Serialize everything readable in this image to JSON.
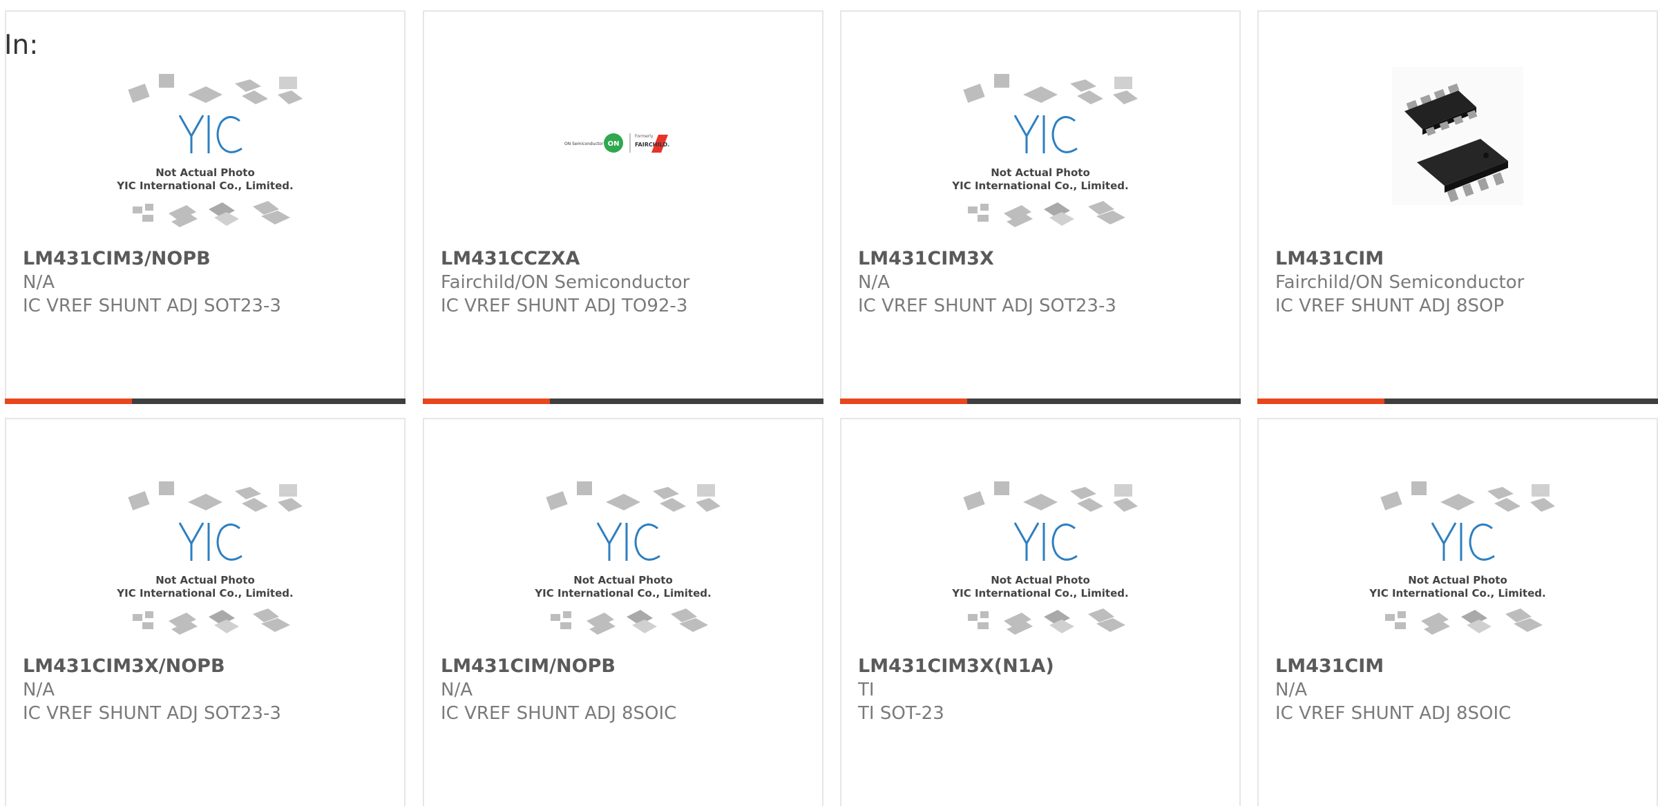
{
  "header": {
    "in_label": "In:"
  },
  "placeholder_image": {
    "line1": "Not Actual Photo",
    "line2": "YIC International Co., Limited.",
    "logo_text": "YIC"
  },
  "manufacturer_logo": {
    "left_text": "ON Semiconductor",
    "badge_text": "ON",
    "right_top": "Formerly",
    "right_bottom": "FAIRCHILD."
  },
  "products": [
    {
      "part_number": "LM431CIM3/NOPB",
      "manufacturer": "N/A",
      "description": "IC VREF SHUNT ADJ SOT23-3",
      "image": "placeholder"
    },
    {
      "part_number": "LM431CCZXA",
      "manufacturer": "Fairchild/ON Semiconductor",
      "description": "IC VREF SHUNT ADJ TO92-3",
      "image": "on-fairchild-logo"
    },
    {
      "part_number": "LM431CIM3X",
      "manufacturer": "N/A",
      "description": "IC VREF SHUNT ADJ SOT23-3",
      "image": "placeholder"
    },
    {
      "part_number": "LM431CIM",
      "manufacturer": "Fairchild/ON Semiconductor",
      "description": "IC VREF SHUNT ADJ 8SOP",
      "image": "soic-chip-photo"
    },
    {
      "part_number": "LM431CIM3X/NOPB",
      "manufacturer": "N/A",
      "description": "IC VREF SHUNT ADJ SOT23-3",
      "image": "placeholder"
    },
    {
      "part_number": "LM431CIM/NOPB",
      "manufacturer": "N/A",
      "description": "IC VREF SHUNT ADJ 8SOIC",
      "image": "placeholder"
    },
    {
      "part_number": "LM431CIM3X(N1A)",
      "manufacturer": "TI",
      "description": "TI SOT-23",
      "image": "placeholder"
    },
    {
      "part_number": "LM431CIM",
      "manufacturer": "N/A",
      "description": "IC VREF SHUNT ADJ 8SOIC",
      "image": "placeholder"
    }
  ],
  "colors": {
    "accent": "#e8461c",
    "bar": "#3f3f3f",
    "logo_blue": "#2d7fc1",
    "text_bold": "#5a5a5a",
    "text": "#7a7a7a"
  }
}
